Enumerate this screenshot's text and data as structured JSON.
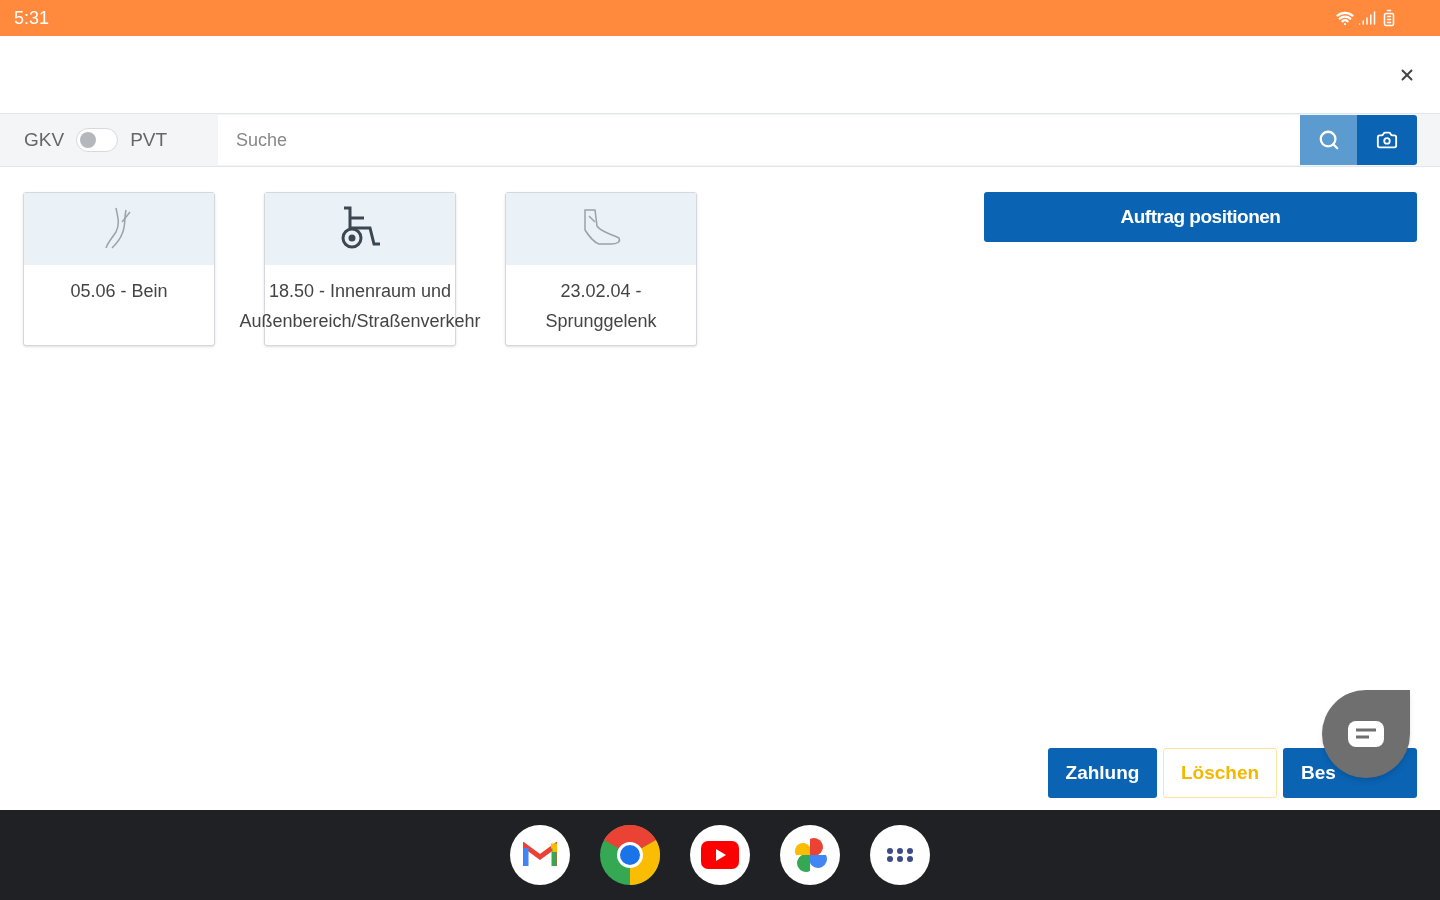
{
  "status_bar": {
    "time": "5:31"
  },
  "filter": {
    "left_label": "GKV",
    "right_label": "PVT",
    "checked": false
  },
  "search": {
    "placeholder": "Suche"
  },
  "cards": [
    {
      "kind": "leg",
      "label": "05.06 - Bein"
    },
    {
      "kind": "wheelchair",
      "label": "18.50 - Innenraum und Außenbereich/Straßenverkehr"
    },
    {
      "kind": "foot",
      "label": "23.02.04 - Sprunggelenk"
    }
  ],
  "position_button": "Auftrag positionen",
  "actions": [
    {
      "kind": "primary",
      "label": "Zahlung"
    },
    {
      "kind": "outline",
      "label": "Löschen"
    },
    {
      "kind": "primary",
      "label": "Bes"
    }
  ],
  "dock": [
    {
      "kind": "mail"
    },
    {
      "kind": "browser"
    },
    {
      "kind": "video"
    },
    {
      "kind": "photos"
    },
    {
      "kind": "apps"
    }
  ]
}
